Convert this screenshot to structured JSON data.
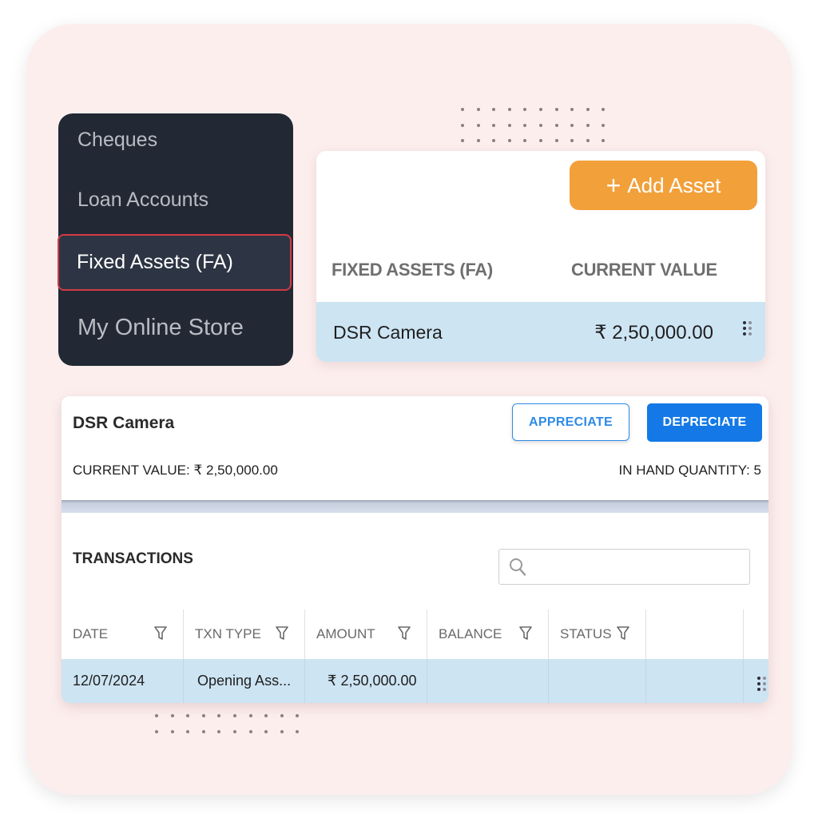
{
  "sidebar": {
    "items": [
      {
        "label": "Cheques",
        "active": false
      },
      {
        "label": "Loan Accounts",
        "active": false
      },
      {
        "label": "Fixed Assets (FA)",
        "active": true
      },
      {
        "label": "My Online Store",
        "active": false
      }
    ]
  },
  "asset_list": {
    "add_button_label": "Add Asset",
    "add_button_icon": "plus-icon",
    "columns": [
      "FIXED ASSETS (FA)",
      "CURRENT VALUE"
    ],
    "rows": [
      {
        "name": "DSR Camera",
        "value": "₹ 2,50,000.00",
        "menu_icon": "drag-handle-icon"
      }
    ]
  },
  "asset_detail": {
    "title": "DSR Camera",
    "appreciate_label": "APPRECIATE",
    "depreciate_label": "DEPRECIATE",
    "current_value_text": "CURRENT VALUE: ₹ 2,50,000.00",
    "in_hand_quantity_text": "IN HAND QUANTITY: 5",
    "transactions": {
      "title": "TRANSACTIONS",
      "search": {
        "value": "",
        "placeholder": "",
        "icon": "search-icon"
      },
      "columns": [
        {
          "label": "DATE",
          "filter": true
        },
        {
          "label": "TXN TYPE",
          "filter": true
        },
        {
          "label": "AMOUNT",
          "filter": true
        },
        {
          "label": "BALANCE",
          "filter": true
        },
        {
          "label": "STATUS",
          "filter": true
        },
        {
          "label": "",
          "filter": false
        }
      ],
      "rows": [
        {
          "date": "12/07/2024",
          "txn_type": "Opening Ass...",
          "amount": "₹ 2,50,000.00",
          "balance": "",
          "status": ""
        }
      ]
    }
  },
  "colors": {
    "background_card": "#fdeeee",
    "sidebar_bg": "#222935",
    "active_border": "#d23a44",
    "add_button": "#f2a03a",
    "primary_blue": "#1479e6",
    "row_highlight": "#cde4f3"
  }
}
